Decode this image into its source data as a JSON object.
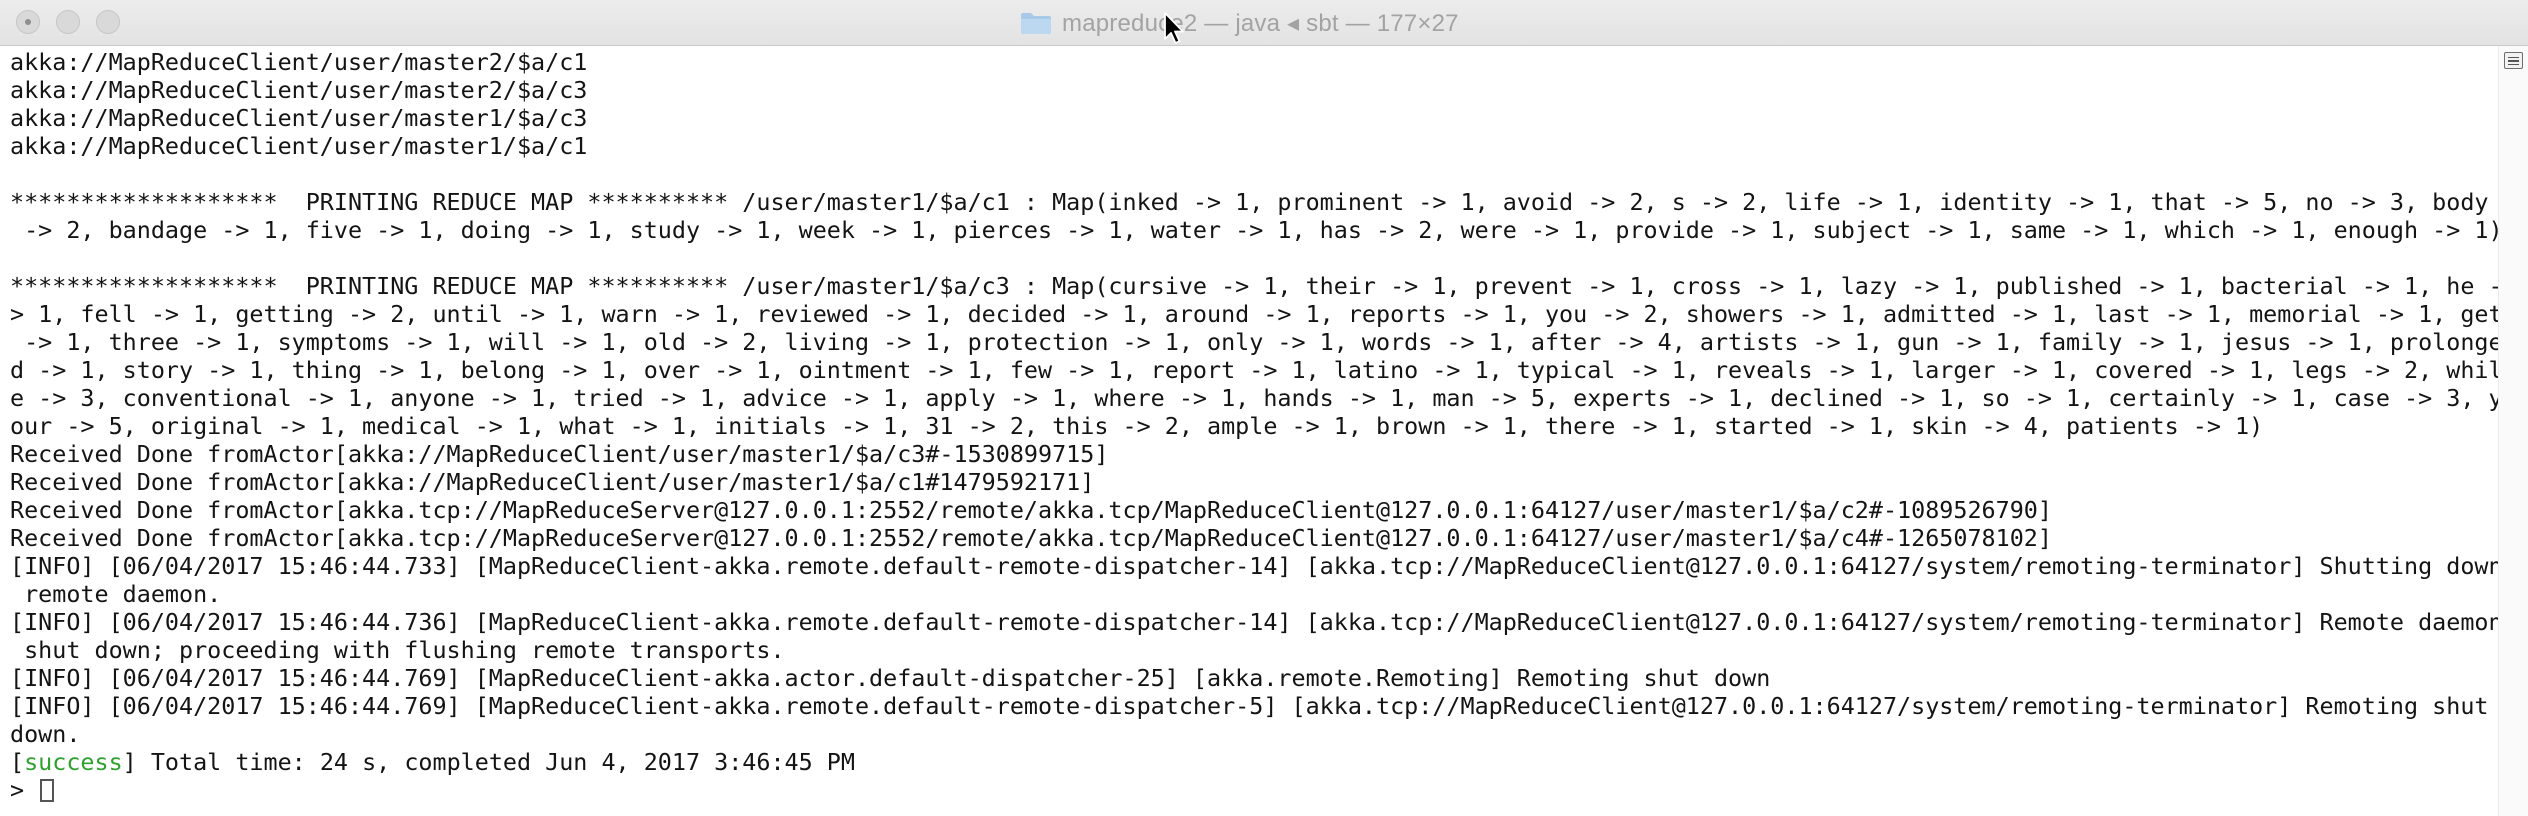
{
  "window": {
    "folder_icon": "folder-icon",
    "title": "mapreduce2 — java ◂ sbt — 177×27"
  },
  "terminal": {
    "lines": [
      "akka://MapReduceClient/user/master2/$a/c1",
      "akka://MapReduceClient/user/master2/$a/c3",
      "akka://MapReduceClient/user/master1/$a/c3",
      "akka://MapReduceClient/user/master1/$a/c1",
      "",
      "*******************  PRINTING REDUCE MAP ********** /user/master1/$a/c1 : Map(inked -> 1, prominent -> 1, avoid -> 2, s -> 2, life -> 1, identity -> 1, that -> 5, no -> 3, body",
      " -> 2, bandage -> 1, five -> 1, doing -> 1, study -> 1, week -> 1, pierces -> 1, water -> 1, has -> 2, were -> 1, provide -> 1, subject -> 1, same -> 1, which -> 1, enough -> 1)",
      "",
      "*******************  PRINTING REDUCE MAP ********** /user/master1/$a/c3 : Map(cursive -> 1, their -> 1, prevent -> 1, cross -> 1, lazy -> 1, published -> 1, bacterial -> 1, he -",
      "> 1, fell -> 1, getting -> 2, until -> 1, warn -> 1, reviewed -> 1, decided -> 1, around -> 1, reports -> 1, you -> 2, showers -> 1, admitted -> 1, last -> 1, memorial -> 1, get",
      " -> 1, three -> 1, symptoms -> 1, will -> 1, old -> 2, living -> 1, protection -> 1, only -> 1, words -> 1, after -> 4, artists -> 1, gun -> 1, family -> 1, jesus -> 1, prolonge",
      "d -> 1, story -> 1, thing -> 1, belong -> 1, over -> 1, ointment -> 1, few -> 1, report -> 1, latino -> 1, typical -> 1, reveals -> 1, larger -> 1, covered -> 1, legs -> 2, whil",
      "e -> 3, conventional -> 1, anyone -> 1, tried -> 1, advice -> 1, apply -> 1, where -> 1, hands -> 1, man -> 5, experts -> 1, declined -> 1, so -> 1, certainly -> 1, case -> 3, y",
      "our -> 5, original -> 1, medical -> 1, what -> 1, initials -> 1, 31 -> 2, this -> 2, ample -> 1, brown -> 1, there -> 1, started -> 1, skin -> 4, patients -> 1)",
      "Received Done fromActor[akka://MapReduceClient/user/master1/$a/c3#-1530899715]",
      "Received Done fromActor[akka://MapReduceClient/user/master1/$a/c1#1479592171]",
      "Received Done fromActor[akka.tcp://MapReduceServer@127.0.0.1:2552/remote/akka.tcp/MapReduceClient@127.0.0.1:64127/user/master1/$a/c2#-1089526790]",
      "Received Done fromActor[akka.tcp://MapReduceServer@127.0.0.1:2552/remote/akka.tcp/MapReduceClient@127.0.0.1:64127/user/master1/$a/c4#-1265078102]",
      "[INFO] [06/04/2017 15:46:44.733] [MapReduceClient-akka.remote.default-remote-dispatcher-14] [akka.tcp://MapReduceClient@127.0.0.1:64127/system/remoting-terminator] Shutting down",
      " remote daemon.",
      "[INFO] [06/04/2017 15:46:44.736] [MapReduceClient-akka.remote.default-remote-dispatcher-14] [akka.tcp://MapReduceClient@127.0.0.1:64127/system/remoting-terminator] Remote daemon",
      " shut down; proceeding with flushing remote transports.",
      "[INFO] [06/04/2017 15:46:44.769] [MapReduceClient-akka.actor.default-dispatcher-25] [akka.remote.Remoting] Remoting shut down",
      "[INFO] [06/04/2017 15:46:44.769] [MapReduceClient-akka.remote.default-remote-dispatcher-5] [akka.tcp://MapReduceClient@127.0.0.1:64127/system/remoting-terminator] Remoting shut",
      "down."
    ],
    "status_line": {
      "open_bracket": "[",
      "status": "success",
      "rest": "] Total time: 24 s, completed Jun 4, 2017 3:46:45 PM",
      "status_color": "#2ea12e"
    },
    "prompt": "> "
  }
}
